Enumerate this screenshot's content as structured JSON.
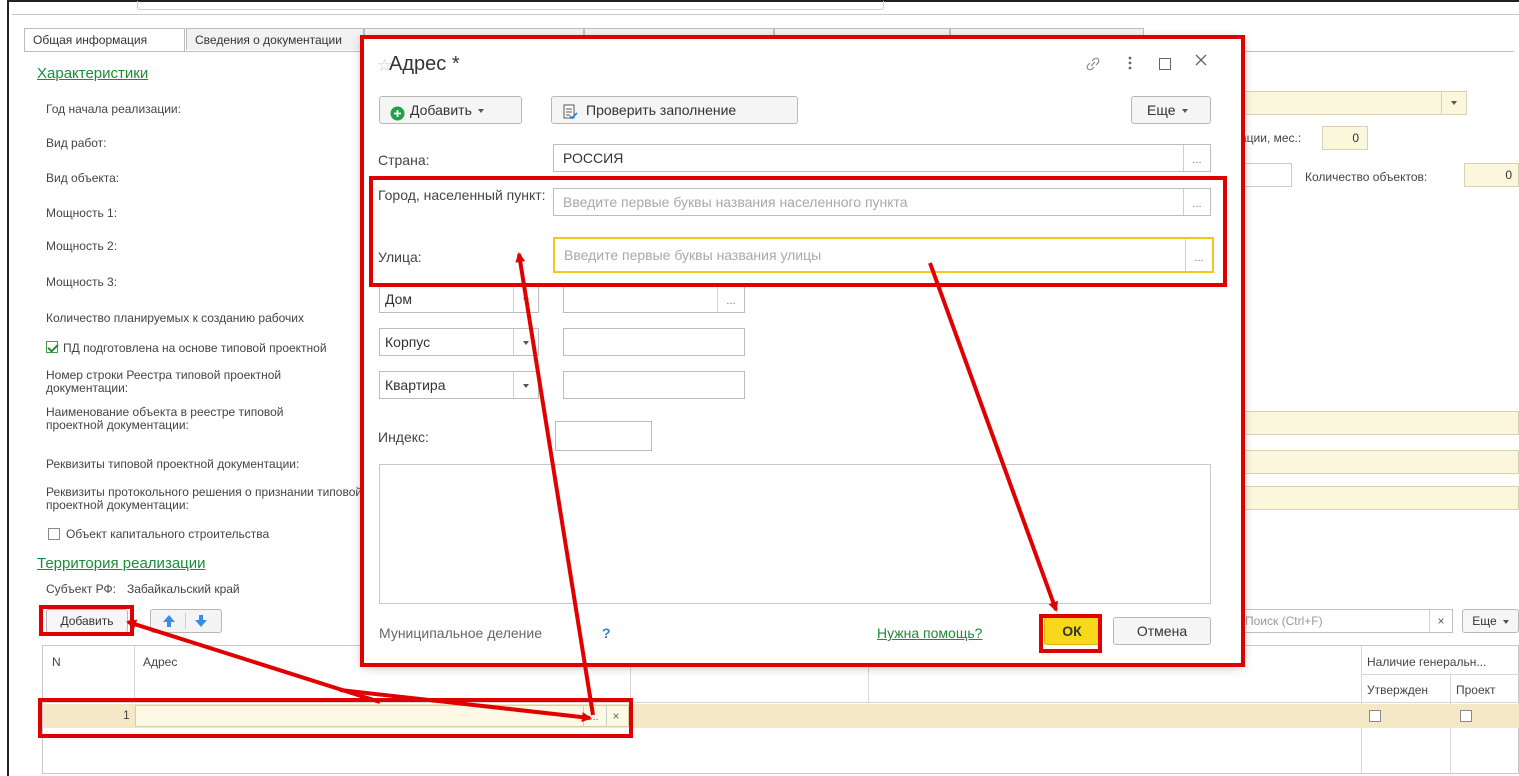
{
  "tabs": [
    "Общая информация",
    "Сведения о документации"
  ],
  "characteristics": {
    "title": "Характеристики",
    "year_label": "Год начала реализации:",
    "work_type_label": "Вид работ:",
    "object_type_label": "Вид объекта:",
    "power1_label": "Мощность 1:",
    "power2_label": "Мощность 2:",
    "power3_label": "Мощность 3:",
    "jobs_label": "Количество планируемых к созданию рабочих",
    "pd_check_label": "ПД подготовлена на основе типовой проектной",
    "registry_row_label": "Номер строки Реестра типовой проектной документации:",
    "registry_name_label": "Наименование объекта в реестре типовой проектной документации:",
    "requisites_label": "Реквизиты типовой проектной документации:",
    "protocol_label": "Реквизиты протокольного решения о признании типовой проектной документации:",
    "capital_label": "Объект капитального строительства",
    "duration_label": "ации, мес.:",
    "duration_value": "0",
    "objects_count_label": "Количество объектов:",
    "objects_count_value": "0"
  },
  "territory": {
    "title": "Территория реализации",
    "subject_label": "Субъект РФ:",
    "subject_value": "Забайкальский край",
    "add_label": "Добавить",
    "search_placeholder": "Поиск (Ctrl+F)",
    "more_label": "Еще",
    "clear_symbol": "×"
  },
  "table": {
    "col_n": "N",
    "col_address": "Адрес",
    "col_master": "Наличие генеральн...",
    "col_approved": "Утвержден",
    "col_project": "Проект",
    "rows": [
      {
        "n": "1",
        "address": ""
      }
    ]
  },
  "modal": {
    "title": "Адрес *",
    "add_label": "Добавить",
    "check_label": "Проверить заполнение",
    "more_label": "Еще",
    "country_label": "Страна:",
    "country_value": "РОССИЯ",
    "city_label": "Город, населенный пункт:",
    "city_placeholder": "Введите первые буквы названия населенного пункта",
    "street_label": "Улица:",
    "street_placeholder": "Введите первые буквы названия улицы",
    "house_type": "Дом",
    "building_type": "Корпус",
    "apartment_type": "Квартира",
    "index_label": "Индекс:",
    "municipal_label": "Муниципальное деление",
    "help_q": "?",
    "help_link": "Нужна помощь?",
    "ok_label": "ОК",
    "cancel_label": "Отмена",
    "dots": "..."
  },
  "colors": {
    "green_link": "#1a8c3a",
    "annotation_red": "#e00000",
    "ok_yellow": "#f7d81a",
    "field_yellow": "#fbf7dd",
    "row_highlight": "#f5e8c6"
  },
  "icons": [
    "star-icon",
    "link-icon",
    "kebab-icon",
    "maximize-icon",
    "close-icon",
    "plus-circle-icon",
    "check-doc-icon",
    "arrow-up-icon",
    "arrow-down-icon"
  ]
}
